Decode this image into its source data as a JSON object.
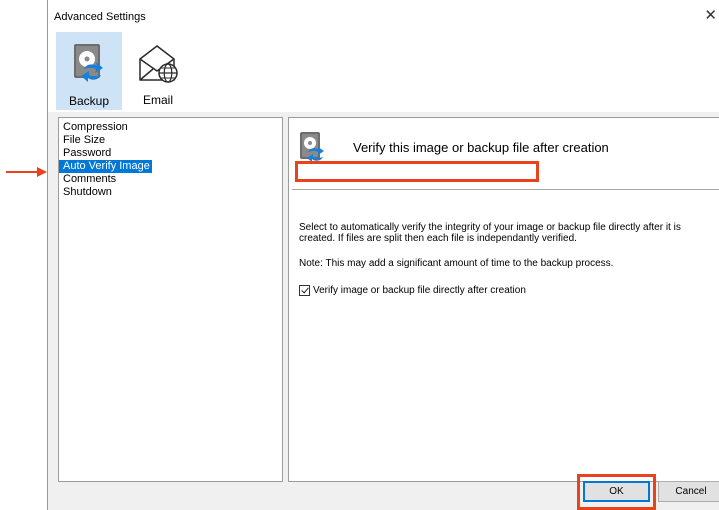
{
  "window": {
    "title": "Advanced Settings",
    "close_glyph": "✕"
  },
  "toolbar": {
    "items": [
      {
        "label": "Backup",
        "icon": "disk-backup-icon",
        "selected": true
      },
      {
        "label": "Email",
        "icon": "email-globe-icon",
        "selected": false
      }
    ]
  },
  "list": {
    "items": [
      "Compression",
      "File Size",
      "Password",
      "Auto Verify Image",
      "Comments",
      "Shutdown"
    ],
    "selected": "Auto Verify Image"
  },
  "panel": {
    "heading": "Verify this image or backup file after creation",
    "description": "Select to automatically verify the integrity of your image or backup file directly after it is created. If files are split then each file is independantly verified.",
    "note": "Note: This may add a significant amount of time to the backup process.",
    "checkbox": {
      "label": "Verify image or backup file directly after creation",
      "checked": true
    }
  },
  "buttons": {
    "ok": "OK",
    "cancel": "Cancel"
  },
  "colors": {
    "highlight": "#e8431c",
    "selection": "#0078d7",
    "toolbar_selected": "#cfe3f7"
  }
}
